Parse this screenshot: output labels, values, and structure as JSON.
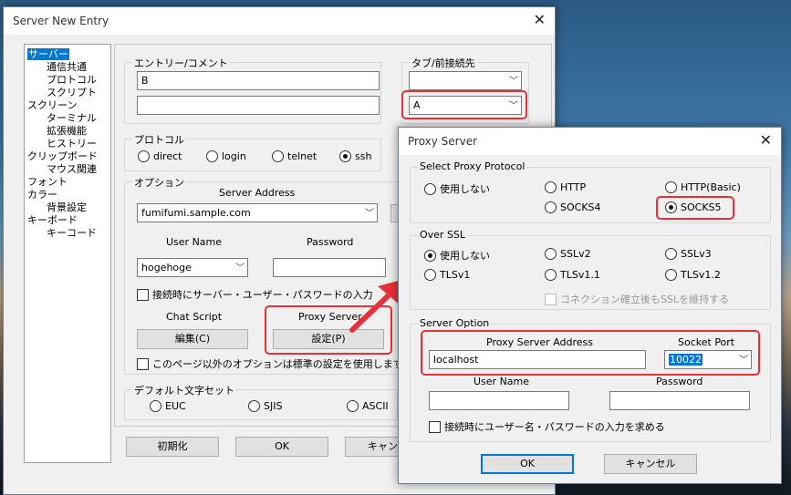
{
  "main_window": {
    "title": "Server New Entry",
    "close_glyph": "✕",
    "tree": [
      "サーバー",
      "通信共通",
      "プロトコル",
      "スクリプト",
      "スクリーン",
      "ターミナル",
      "拡張機能",
      "ヒストリー",
      "クリップボード",
      "マウス関連",
      "フォント",
      "カラー",
      "背景設定",
      "キーボード",
      "キーコード"
    ],
    "entry_group": "エントリー/コメント",
    "entry_value": "B",
    "comment_value": "",
    "tab_group": "タブ/前接続先",
    "tab_value": "",
    "dest_value": "A",
    "protocol_group": "プロトコル",
    "protocols": [
      "direct",
      "login",
      "telnet",
      "ssh"
    ],
    "protocol_selected": "ssh",
    "options_group": "オプション",
    "server_address_label": "Server Address",
    "server_address": "fumifumi.sample.com",
    "user_name_label": "User Name",
    "user_name": "hogehoge",
    "password_label": "Password",
    "password": "",
    "connect_checkbox": "接続時にサーバー・ユーザー・パスワードの入力",
    "chat_script_label": "Chat Script",
    "edit_button": "編集(C)",
    "proxy_server_label": "Proxy Server",
    "settings_button": "設定(P)",
    "use_default_checkbox": "このページ以外のオプションは標準の設定を使用します",
    "charset_group": "デフォルト文字セット",
    "charsets": [
      "EUC",
      "SJIS",
      "ASCII"
    ],
    "init_button": "初期化",
    "ok_button": "OK",
    "cancel_button": "キャン"
  },
  "proxy_dialog": {
    "title": "Proxy Server",
    "close_glyph": "✕",
    "select_group": "Select Proxy Protocol",
    "protocols": [
      "使用しない",
      "HTTP",
      "HTTP(Basic)",
      "SOCKS4",
      "SOCKS5"
    ],
    "protocol_selected": "SOCKS5",
    "ssl_group": "Over SSL",
    "ssl_options": [
      "使用しない",
      "SSLv2",
      "SSLv3",
      "TLSv1",
      "TLSv1.1",
      "TLSv1.2"
    ],
    "ssl_selected": "使用しない",
    "ssl_keep_checkbox": "コネクション確立後もSSLを維持する",
    "server_group": "Server Option",
    "proxy_address_label": "Proxy Server Address",
    "proxy_address": "localhost",
    "socket_port_label": "Socket Port",
    "socket_port": "10022",
    "user_name_label": "User Name",
    "password_label": "Password",
    "user_name": "",
    "password": "",
    "auth_checkbox": "接続時にユーザー名・パスワードの入力を求める",
    "ok_button": "OK",
    "cancel_button": "キャンセル"
  },
  "colors": {
    "highlight": "#e8303a",
    "selection": "#0078d7"
  }
}
